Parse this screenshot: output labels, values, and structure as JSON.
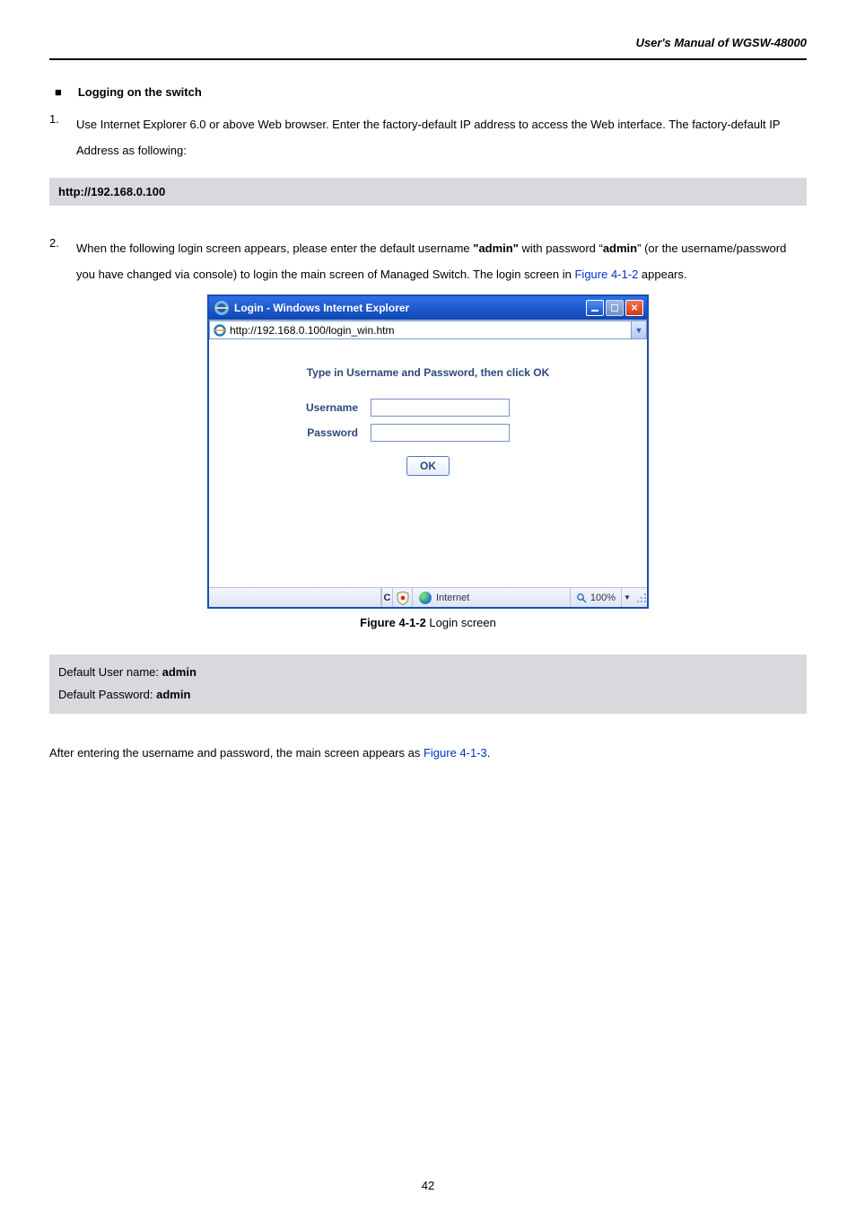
{
  "header": {
    "title": "User's Manual of WGSW-48000"
  },
  "section": {
    "heading": "Logging on the switch"
  },
  "step1": {
    "no": "1.",
    "text_a": "Use Internet Explorer 6.0 or above Web browser. Enter the factory-default IP address to access the Web interface. The factory-default IP Address as following:"
  },
  "codebox": {
    "text": "http://192.168.0.100"
  },
  "step2": {
    "no": "2.",
    "pre": "When the following login screen appears, please enter the default username ",
    "u1": "\"admin\"",
    "mid": " with password “",
    "u2": "admin",
    "post1": "” (or the username/password you have changed via console) to login the main screen of Managed Switch. The login screen in ",
    "figref": "Figure 4-1-2",
    "post2": " appears."
  },
  "ie": {
    "title": "Login - Windows Internet Explorer",
    "url": "http://192.168.0.100/login_win.htm",
    "hint": "Type in Username and Password, then click OK",
    "username_label": "Username",
    "password_label": "Password",
    "ok_label": "OK",
    "zone": "Internet",
    "zoom": "100%"
  },
  "caption": {
    "bold": "Figure 4-1-2",
    "rest": " Login screen"
  },
  "creds": {
    "line1_a": "Default User name: ",
    "line1_b": "admin",
    "line2_a": "Default Password: ",
    "line2_b": "admin"
  },
  "after": {
    "pre": "After entering the username and password, the main screen appears as ",
    "figref": "Figure 4-1-3",
    "post": "."
  },
  "page_number": "42"
}
